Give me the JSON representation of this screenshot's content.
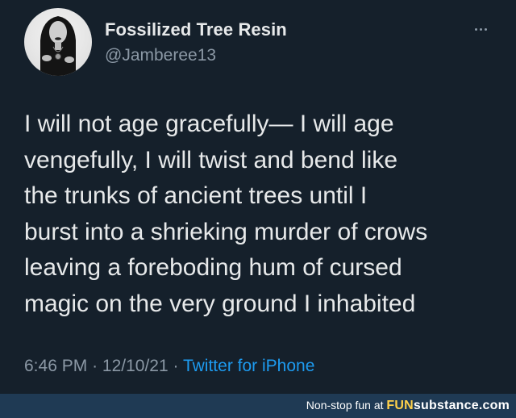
{
  "author": {
    "display_name": "Fossilized Tree Resin",
    "handle": "@Jamberee13"
  },
  "tweet": {
    "lines": [
      "I will not age gracefully— I will age",
      "vengefully, I will twist and bend like",
      "the trunks of ancient trees until I",
      "burst into a shrieking murder of crows",
      "leaving a foreboding hum of cursed",
      "magic on the very ground I inhabited"
    ]
  },
  "meta": {
    "time": "6:46 PM",
    "separator_1": "·",
    "date": "12/10/21",
    "separator_2": "·",
    "source": "Twitter for iPhone"
  },
  "watermark": {
    "prefix": "Non-stop fun at ",
    "brand_fun": "FUN",
    "brand_rest": "substance.com"
  },
  "icons": {
    "more": "more-horizontal-icon"
  },
  "colors": {
    "background": "#15202b",
    "text_primary": "#e7e9ea",
    "text_secondary": "#8b98a5",
    "link": "#1d9bf0",
    "footer_bar": "#1f3a54"
  }
}
